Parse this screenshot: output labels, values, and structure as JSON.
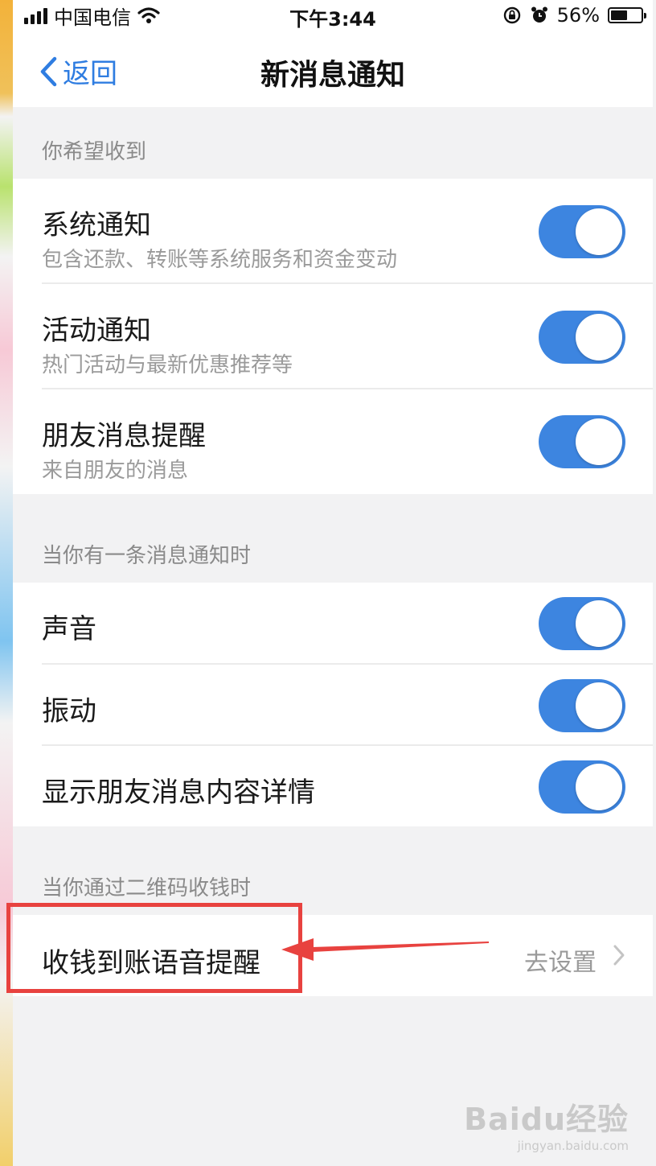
{
  "status_bar": {
    "carrier": "中国电信",
    "time": "下午3:44",
    "battery_percent": "56%",
    "battery_level": 0.56
  },
  "nav": {
    "back_label": "返回",
    "title": "新消息通知"
  },
  "sections": [
    {
      "header": "你希望收到",
      "rows": [
        {
          "title": "系统通知",
          "subtitle": "包含还款、转账等系统服务和资金变动",
          "enabled": true
        },
        {
          "title": "活动通知",
          "subtitle": "热门活动与最新优惠推荐等",
          "enabled": true
        },
        {
          "title": "朋友消息提醒",
          "subtitle": "来自朋友的消息",
          "enabled": true
        }
      ]
    },
    {
      "header": "当你有一条消息通知时",
      "rows": [
        {
          "title": "声音",
          "enabled": true
        },
        {
          "title": "振动",
          "enabled": true
        },
        {
          "title": "显示朋友消息内容详情",
          "enabled": true
        }
      ]
    },
    {
      "header": "当你通过二维码收钱时",
      "rows": [
        {
          "title": "收钱到账语音提醒",
          "action": "去设置"
        }
      ]
    }
  ],
  "watermark": {
    "brand": "Baidu经验",
    "url": "jingyan.baidu.com"
  },
  "colors": {
    "accent_blue": "#3d85e0",
    "annotation_red": "#e8423f",
    "background": "#f2f2f3"
  },
  "icons": {
    "signal": "cellular-signal-icon",
    "wifi": "wifi-icon",
    "rotation_lock": "rotation-lock-icon",
    "alarm": "alarm-clock-icon",
    "battery": "battery-icon",
    "back": "chevron-left-icon",
    "disclosure": "chevron-right-icon",
    "annotation": "red-arrow-annotation"
  }
}
